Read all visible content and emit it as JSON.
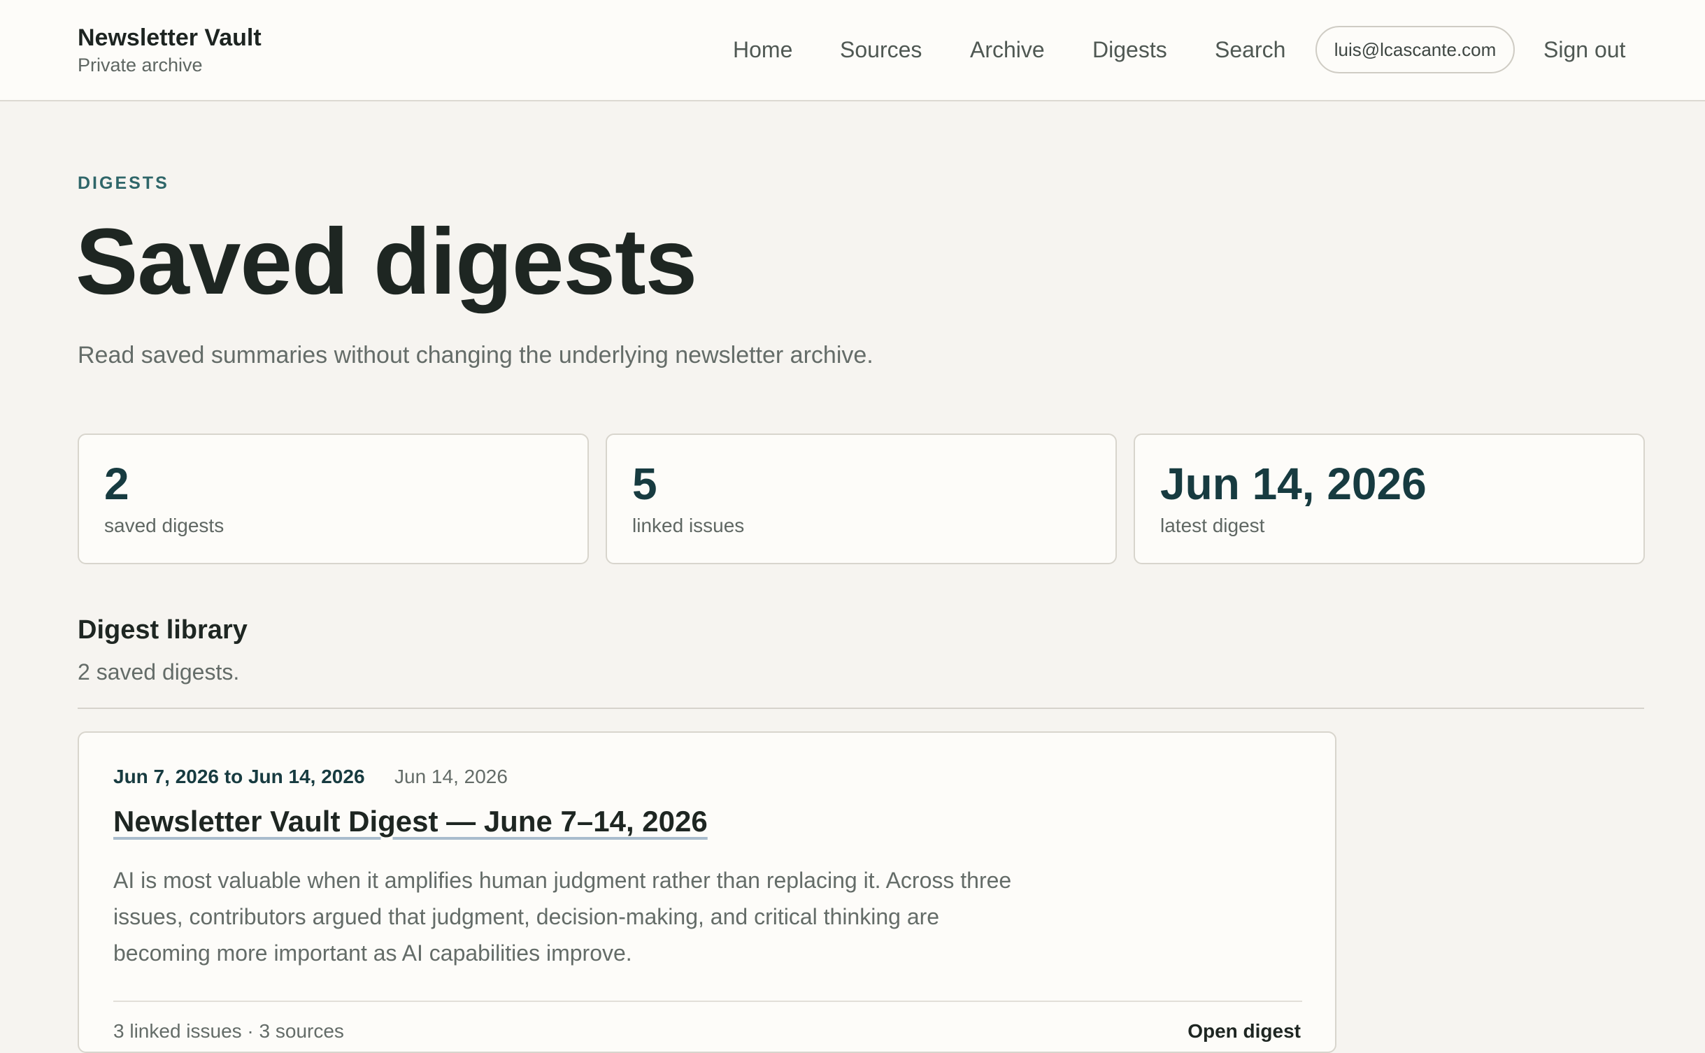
{
  "header": {
    "brand_name": "Newsletter Vault",
    "brand_sub": "Private archive",
    "nav": [
      "Home",
      "Sources",
      "Archive",
      "Digests",
      "Search"
    ],
    "user_email": "luis@lcascante.com",
    "sign_out": "Sign out"
  },
  "page": {
    "eyebrow": "DIGESTS",
    "title": "Saved digests",
    "subtitle": "Read saved summaries without changing the underlying newsletter archive."
  },
  "stats": [
    {
      "value": "2",
      "label": "saved digests"
    },
    {
      "value": "5",
      "label": "linked issues"
    },
    {
      "value": "Jun 14, 2026",
      "label": "latest digest"
    }
  ],
  "library": {
    "title": "Digest library",
    "count_text": "2 saved digests.",
    "digests": [
      {
        "range": "Jun 7, 2026 to Jun 14, 2026",
        "date": "Jun 14, 2026",
        "title": "Newsletter Vault Digest — June 7–14, 2026",
        "summary": "AI is most valuable when it amplifies human judgment rather than replacing it. Across three issues, contributors argued that judgment, decision-making, and critical thinking are becoming more important as AI capabilities improve.",
        "meta": "3 linked issues · 3 sources",
        "open_label": "Open digest"
      }
    ]
  },
  "colors": {
    "accent": "#173b40",
    "eyebrow": "#2f6669",
    "background": "#f6f4f0",
    "surface": "#fdfcf9"
  }
}
